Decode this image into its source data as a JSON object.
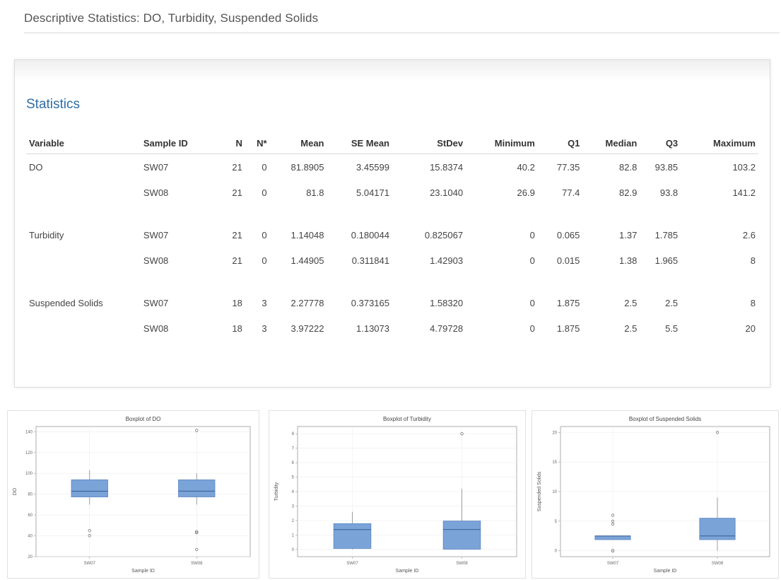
{
  "page": {
    "title": "Descriptive Statistics: DO, Turbidity, Suspended Solids"
  },
  "statistics": {
    "title": "Statistics",
    "columns": [
      "Variable",
      "Sample ID",
      "N",
      "N*",
      "Mean",
      "SE Mean",
      "StDev",
      "Minimum",
      "Q1",
      "Median",
      "Q3",
      "Maximum"
    ],
    "rows": [
      {
        "variable": "DO",
        "sample": "SW07",
        "n": "21",
        "nstar": "0",
        "mean": "81.8905",
        "semean": "3.45599",
        "stdev": "15.8374",
        "min": "40.2",
        "q1": "77.35",
        "median": "82.8",
        "q3": "93.85",
        "max": "103.2"
      },
      {
        "variable": "",
        "sample": "SW08",
        "n": "21",
        "nstar": "0",
        "mean": "81.8",
        "semean": "5.04171",
        "stdev": "23.1040",
        "min": "26.9",
        "q1": "77.4",
        "median": "82.9",
        "q3": "93.8",
        "max": "141.2"
      },
      {
        "variable": "Turbidity",
        "sample": "SW07",
        "n": "21",
        "nstar": "0",
        "mean": "1.14048",
        "semean": "0.180044",
        "stdev": "0.825067",
        "min": "0",
        "q1": "0.065",
        "median": "1.37",
        "q3": "1.785",
        "max": "2.6"
      },
      {
        "variable": "",
        "sample": "SW08",
        "n": "21",
        "nstar": "0",
        "mean": "1.44905",
        "semean": "0.311841",
        "stdev": "1.42903",
        "min": "0",
        "q1": "0.015",
        "median": "1.38",
        "q3": "1.965",
        "max": "8"
      },
      {
        "variable": "Suspended Solids",
        "sample": "SW07",
        "n": "18",
        "nstar": "3",
        "mean": "2.27778",
        "semean": "0.373165",
        "stdev": "1.58320",
        "min": "0",
        "q1": "1.875",
        "median": "2.5",
        "q3": "2.5",
        "max": "8"
      },
      {
        "variable": "",
        "sample": "SW08",
        "n": "18",
        "nstar": "3",
        "mean": "3.97222",
        "semean": "1.13073",
        "stdev": "4.79728",
        "min": "0",
        "q1": "1.875",
        "median": "2.5",
        "q3": "5.5",
        "max": "20"
      }
    ]
  },
  "colors": {
    "box_fill": "#7aa3d8",
    "box_stroke": "#5b86c0",
    "accent": "#2e6da4"
  },
  "chart_data": [
    {
      "type": "boxplot",
      "title": "Boxplot of DO",
      "xlabel": "Sample ID",
      "ylabel": "DO",
      "ylim": [
        20,
        145
      ],
      "yticks": [
        20,
        40,
        60,
        80,
        100,
        120,
        140
      ],
      "categories": [
        "SW07",
        "SW08"
      ],
      "boxes": [
        {
          "q1": 77.35,
          "median": 82.8,
          "q3": 93.85,
          "whisker_low": 70,
          "whisker_high": 103.2,
          "outliers": [
            40.2,
            45
          ]
        },
        {
          "q1": 77.4,
          "median": 82.9,
          "q3": 93.8,
          "whisker_low": 70,
          "whisker_high": 100,
          "outliers": [
            26.9,
            43,
            44,
            141.2
          ]
        }
      ]
    },
    {
      "type": "boxplot",
      "title": "Boxplot of Turbidity",
      "xlabel": "Sample ID",
      "ylabel": "Turbidity",
      "ylim": [
        -0.5,
        8.5
      ],
      "yticks": [
        0,
        1,
        2,
        3,
        4,
        5,
        6,
        7,
        8
      ],
      "categories": [
        "SW07",
        "SW08"
      ],
      "boxes": [
        {
          "q1": 0.065,
          "median": 1.37,
          "q3": 1.785,
          "whisker_low": 0,
          "whisker_high": 2.6,
          "outliers": []
        },
        {
          "q1": 0.015,
          "median": 1.38,
          "q3": 1.965,
          "whisker_low": 0,
          "whisker_high": 4.2,
          "outliers": [
            8
          ]
        }
      ]
    },
    {
      "type": "boxplot",
      "title": "Boxplot of Suspended Solids",
      "xlabel": "Sample ID",
      "ylabel": "Suspended Solids",
      "ylim": [
        -1,
        21
      ],
      "yticks": [
        0,
        5,
        10,
        15,
        20
      ],
      "categories": [
        "SW07",
        "SW08"
      ],
      "boxes": [
        {
          "q1": 1.875,
          "median": 2.5,
          "q3": 2.5,
          "whisker_low": 1.875,
          "whisker_high": 2.5,
          "outliers": [
            0,
            0,
            4.5,
            5,
            6
          ]
        },
        {
          "q1": 1.875,
          "median": 2.5,
          "q3": 5.5,
          "whisker_low": 0,
          "whisker_high": 9,
          "outliers": [
            20
          ]
        }
      ]
    }
  ]
}
